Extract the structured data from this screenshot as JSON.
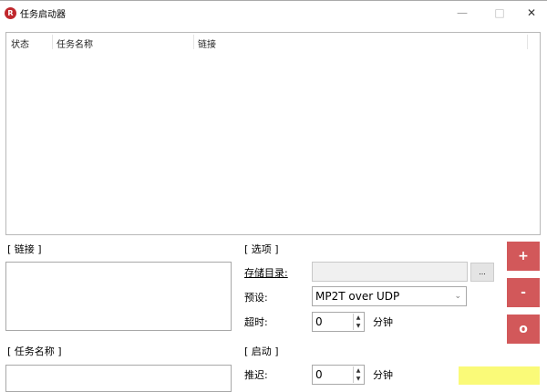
{
  "window": {
    "title": "任务启动器",
    "icon_letter": "R",
    "minimize": "—",
    "maximize": "□",
    "close": "✕"
  },
  "task_list": {
    "columns": [
      "状态",
      "任务名称",
      "链接"
    ]
  },
  "link_section": {
    "label": "[ 链接 ]"
  },
  "name_section": {
    "label": "[ 任务名称 ]"
  },
  "options": {
    "label": "[ 选项 ]",
    "storage_label": "存储目录:",
    "storage_value": "",
    "browse": "...",
    "preset_label": "预设:",
    "preset_value": "MP2T over UDP",
    "timeout_label": "超时:",
    "timeout_value": "0",
    "timeout_unit": "分钟"
  },
  "launch": {
    "label": "[ 启动 ]",
    "delay_label": "推迟:",
    "delay_value": "0",
    "delay_unit": "分钟"
  },
  "buttons": {
    "add": "+",
    "remove": "-",
    "reset": "o"
  }
}
